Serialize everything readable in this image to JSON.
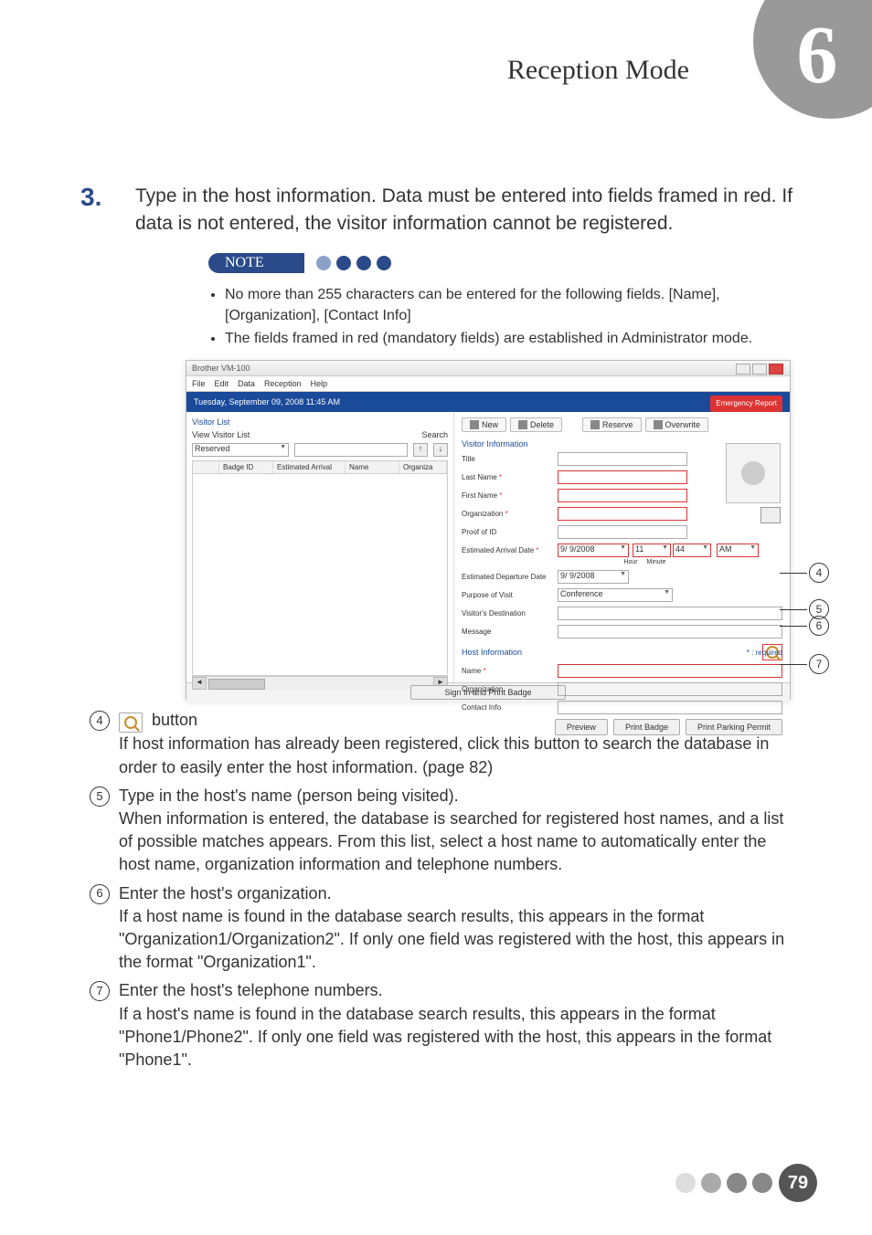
{
  "header": {
    "chapter_title": "Reception Mode",
    "chapter_number": "6"
  },
  "step": {
    "number": "3.",
    "body": "Type in the host information. Data must be entered into fields framed in red. If data is not entered, the visitor information cannot be registered."
  },
  "note": {
    "label": "NOTE",
    "items": [
      "No more than 255 characters can be entered for the following fields. [Name], [Organization], [Contact Info]",
      "The fields framed in red (mandatory fields) are established in Administrator mode."
    ]
  },
  "screenshot": {
    "window_title": "Brother VM-100",
    "menu": [
      "File",
      "Edit",
      "Data",
      "Reception",
      "Help"
    ],
    "datetime": "Tuesday, September 09, 2008 11:45 AM",
    "emergency_btn": "Emergency Report",
    "left": {
      "section": "Visitor List",
      "view_label": "View Visitor List",
      "view_select": "Reserved",
      "search_label": "Search",
      "arrow_up": "↑",
      "arrow_down": "↓",
      "columns": {
        "badge": "Badge ID",
        "arrival": "Estimated Arrival",
        "name": "Name",
        "org": "Organiza"
      }
    },
    "toolbar": {
      "new": "New",
      "delete": "Delete",
      "reserve": "Reserve",
      "overwrite": "Overwrite"
    },
    "vi": {
      "section": "Visitor Information",
      "title": "Title",
      "last_name": "Last Name",
      "first_name": "First Name",
      "organization": "Organization",
      "proof": "Proof of ID",
      "est_arrival": "Estimated Arrival Date",
      "est_departure": "Estimated Departure Date",
      "purpose": "Purpose of Visit",
      "purpose_val": "Conference",
      "destination": "Visitor's Destination",
      "message": "Message",
      "date_val": "9/ 9/2008",
      "hour": "11",
      "min": "44",
      "ampm": "AM",
      "hour_lbl": "Hour",
      "min_lbl": "Minute"
    },
    "hi": {
      "section": "Host Information",
      "name": "Name",
      "organization": "Organization",
      "contact": "Contact Info"
    },
    "required_note": "* : required",
    "buttons": {
      "preview": "Preview",
      "print_badge": "Print Badge",
      "print_permit": "Print Parking Permit",
      "signin": "Sign In and Print Badge"
    }
  },
  "callouts": {
    "c4": "4",
    "c5": "5",
    "c6": "6",
    "c7": "7"
  },
  "explain": {
    "e4": {
      "label": "4",
      "pre": " ",
      "btn_word": "button",
      "body": "If host information has already been registered, click this button to search the database in order to easily enter the host information. (page 82)"
    },
    "e5": {
      "label": "5",
      "title": "Type in the host's name (person being visited).",
      "body": "When information is entered, the database is searched for registered host names, and a list of possible matches appears. From this list, select a host name to automatically enter the host name, organization information and telephone numbers."
    },
    "e6": {
      "label": "6",
      "title": "Enter the host's organization.",
      "body": "If a host name is found in the database search results, this appears in the format \"Organization1/Organization2\". If only one field was registered with the host, this appears in the format \"Organization1\"."
    },
    "e7": {
      "label": "7",
      "title": "Enter the host's telephone numbers.",
      "body": "If a host's name is found in the database search results, this appears in the format \"Phone1/Phone2\". If only one field was registered with the host, this appears in the format \"Phone1\"."
    }
  },
  "page_number": "79"
}
